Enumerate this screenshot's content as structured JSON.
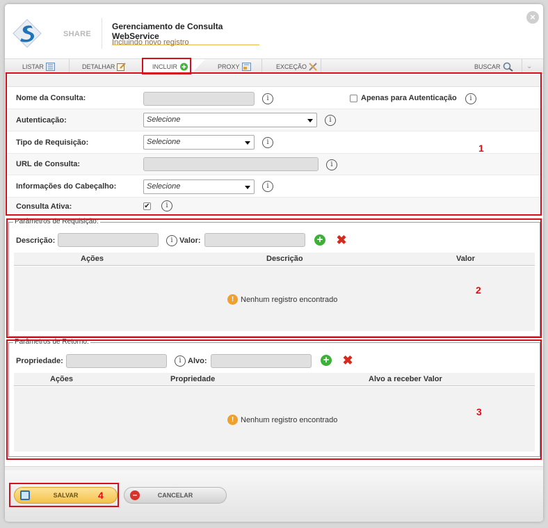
{
  "header": {
    "brand": "SHARE",
    "title": "Gerenciamento de Consulta WebService",
    "subtitle": "Incluindo novo registro"
  },
  "tabs": [
    {
      "label": "LISTAR",
      "icon": "list-icon"
    },
    {
      "label": "DETALHAR",
      "icon": "edit-note-icon"
    },
    {
      "label": "INCLUIR",
      "icon": "add-circle-icon",
      "active": true
    },
    {
      "label": "PROXY",
      "icon": "proxy-icon"
    },
    {
      "label": "EXCEÇÃO",
      "icon": "tools-icon"
    },
    {
      "label": "BUSCAR",
      "icon": "search-icon"
    }
  ],
  "form": {
    "nome_label": "Nome da Consulta:",
    "nome_value": "",
    "apenas_label": "Apenas para Autenticação",
    "apenas_checked": false,
    "autenticacao_label": "Autenticação:",
    "autenticacao_value": "Selecione",
    "tipo_label": "Tipo de Requisição:",
    "tipo_value": "Selecione",
    "url_label": "URL de Consulta:",
    "url_value": "",
    "cabecalho_label": "Informações do Cabeçalho:",
    "cabecalho_value": "Selecione",
    "ativa_label": "Consulta Ativa:",
    "ativa_checked": true
  },
  "requisicao": {
    "legend": "Parâmetros de Requisição:",
    "descricao_label": "Descrição:",
    "valor_label": "Valor:",
    "columns": [
      "Ações",
      "Descrição",
      "Valor"
    ],
    "empty_text": "Nenhum registro encontrado"
  },
  "retorno": {
    "legend": "Parâmetros de Retorno:",
    "propriedade_label": "Propriedade:",
    "alvo_label": "Alvo:",
    "columns": [
      "Ações",
      "Propriedade",
      "Alvo a receber Valor"
    ],
    "empty_text": "Nenhum registro encontrado"
  },
  "footer": {
    "save_label": "SALVAR",
    "cancel_label": "CANCELAR"
  },
  "annotations": {
    "a1": "1",
    "a2": "2",
    "a3": "3",
    "a4": "4"
  },
  "colors": {
    "annotation_red": "#d6101a",
    "save_yellow": "#f4c24a",
    "add_green": "#3db038",
    "delete_red": "#d52b1e",
    "warning_orange": "#f0a02d"
  }
}
